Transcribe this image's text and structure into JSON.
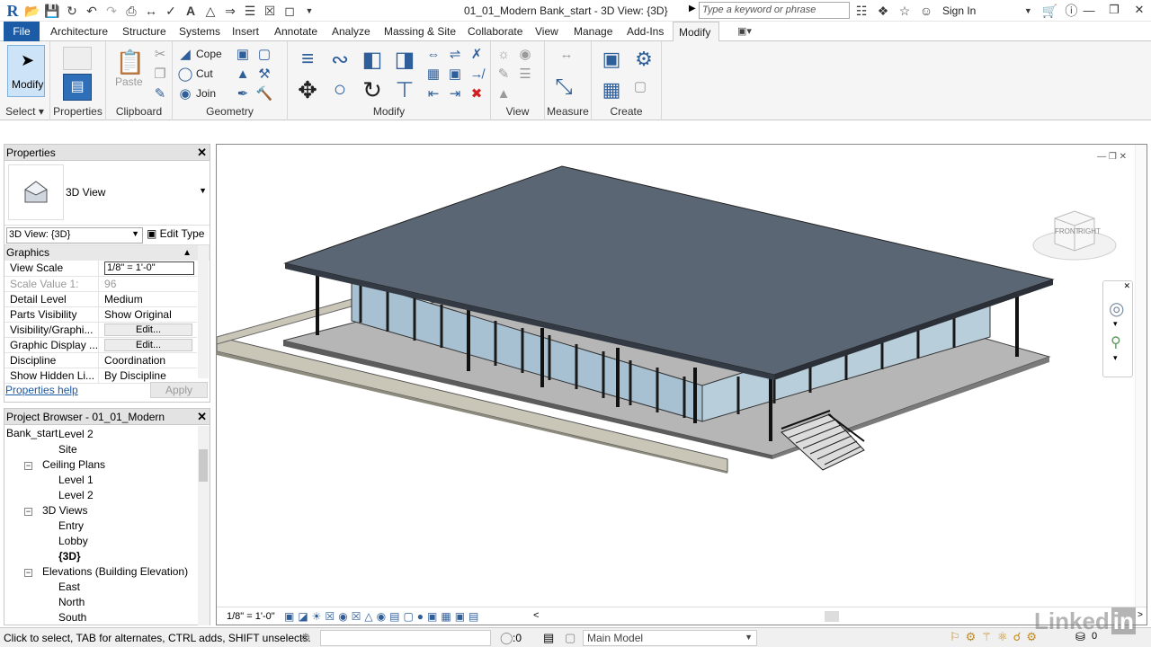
{
  "titlebar": {
    "title": "01_01_Modern Bank_start - 3D View: {3D}",
    "search_placeholder": "Type a keyword or phrase",
    "signin": "Sign In"
  },
  "tabs": [
    "File",
    "Architecture",
    "Structure",
    "Systems",
    "Insert",
    "Annotate",
    "Analyze",
    "Massing & Site",
    "Collaborate",
    "View",
    "Manage",
    "Add-Ins",
    "Modify"
  ],
  "ribbon": {
    "modify_label": "Modify",
    "select_label": "Select",
    "properties_label": "Properties",
    "paste_label": "Paste",
    "clipboard_label": "Clipboard",
    "cope_label": "Cope",
    "cut_label": "Cut",
    "join_label": "Join",
    "geometry_label": "Geometry",
    "modify_panel_label": "Modify",
    "view_label": "View",
    "measure_label": "Measure",
    "create_label": "Create"
  },
  "properties": {
    "header": "Properties",
    "type_name": "3D View",
    "view_selector": "3D View: {3D}",
    "edit_type": "Edit Type",
    "group": "Graphics",
    "rows": [
      {
        "key": "View Scale",
        "value": "1/8\" = 1'-0\"",
        "kind": "input"
      },
      {
        "key": "Scale Value    1:",
        "value": "96",
        "kind": "gray"
      },
      {
        "key": "Detail Level",
        "value": "Medium",
        "kind": "text"
      },
      {
        "key": "Parts Visibility",
        "value": "Show Original",
        "kind": "text"
      },
      {
        "key": "Visibility/Graphi...",
        "value": "Edit...",
        "kind": "button"
      },
      {
        "key": "Graphic Display ...",
        "value": "Edit...",
        "kind": "button"
      },
      {
        "key": "Discipline",
        "value": "Coordination",
        "kind": "text"
      },
      {
        "key": "Show Hidden Li...",
        "value": "By Discipline",
        "kind": "text"
      }
    ],
    "help": "Properties help",
    "apply": "Apply"
  },
  "browser": {
    "header": "Project Browser - 01_01_Modern Bank_start",
    "nodes": [
      {
        "label": "Level 2",
        "level": 2,
        "toggle": ""
      },
      {
        "label": "Site",
        "level": 2,
        "toggle": ""
      },
      {
        "label": "Ceiling Plans",
        "level": 1,
        "toggle": "−"
      },
      {
        "label": "Level 1",
        "level": 2,
        "toggle": ""
      },
      {
        "label": "Level 2",
        "level": 2,
        "toggle": ""
      },
      {
        "label": "3D Views",
        "level": 1,
        "toggle": "−"
      },
      {
        "label": "Entry",
        "level": 2,
        "toggle": ""
      },
      {
        "label": "Lobby",
        "level": 2,
        "toggle": ""
      },
      {
        "label": "{3D}",
        "level": 2,
        "toggle": "",
        "bold": true
      },
      {
        "label": "Elevations (Building Elevation)",
        "level": 1,
        "toggle": "−"
      },
      {
        "label": "East",
        "level": 2,
        "toggle": ""
      },
      {
        "label": "North",
        "level": 2,
        "toggle": ""
      },
      {
        "label": "South",
        "level": 2,
        "toggle": ""
      }
    ]
  },
  "view": {
    "scale": "1/8\" = 1'-0\"",
    "viewcube_front": "FRONT",
    "viewcube_right": "RIGHT"
  },
  "status": {
    "hint": "Click to select, TAB for alternates, CTRL adds, SHIFT unselects.",
    "count": ":0",
    "model": "Main Model"
  },
  "watermark": "Linked in"
}
